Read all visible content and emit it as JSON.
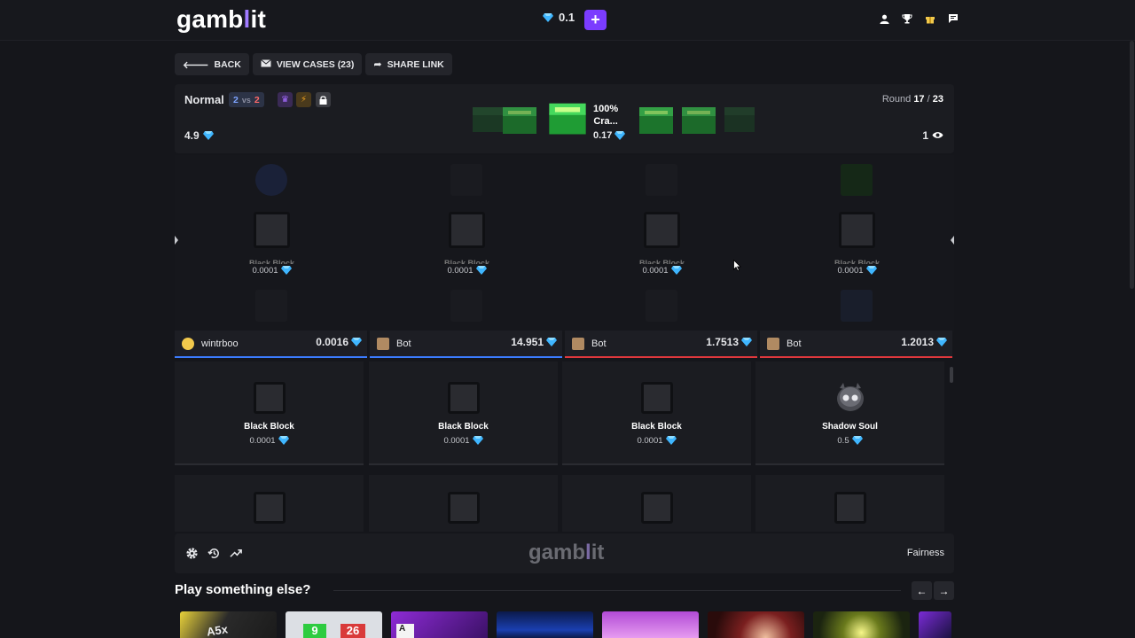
{
  "header": {
    "logo_a": "gamb",
    "logo_b": "l",
    "logo_c": "it",
    "balance": "0.1",
    "plus_label": "+",
    "icons": [
      "user-icon",
      "trophy-icon",
      "gift-icon",
      "chat-icon"
    ]
  },
  "toolbar": {
    "back_label": "BACK",
    "view_cases_label": "VIEW CASES (23)",
    "share_label": "SHARE LINK"
  },
  "battle": {
    "mode": "Normal",
    "team_a": "2",
    "vs": "vs",
    "team_b": "2",
    "total": "4.9",
    "round_label": "Round",
    "round_current": "17",
    "round_sep": "/",
    "round_total": "23",
    "viewers": "1",
    "case_title_1": "100%",
    "case_title_2": "Cra...",
    "case_price": "0.17"
  },
  "spinner": {
    "items": [
      {
        "label": "Black Block",
        "price": "0.0001"
      },
      {
        "label": "Black Block",
        "price": "0.0001"
      },
      {
        "label": "Black Block",
        "price": "0.0001"
      },
      {
        "label": "Black Block",
        "price": "0.0001"
      }
    ]
  },
  "players": [
    {
      "name": "wintrboo",
      "value": "0.0016",
      "team": "blue"
    },
    {
      "name": "Bot",
      "value": "14.951",
      "team": "blue"
    },
    {
      "name": "Bot",
      "value": "1.7513",
      "team": "red"
    },
    {
      "name": "Bot",
      "value": "1.2013",
      "team": "red"
    }
  ],
  "results": [
    {
      "label": "Black Block",
      "price": "0.0001"
    },
    {
      "label": "Black Block",
      "price": "0.0001"
    },
    {
      "label": "Black Block",
      "price": "0.0001"
    },
    {
      "label": "Shadow Soul",
      "price": "0.5"
    }
  ],
  "footer": {
    "logo_a": "gamb",
    "logo_b": "l",
    "logo_c": "it",
    "fairness": "Fairness"
  },
  "play_else": {
    "title": "Play something else?",
    "thumb_1_text": "A5x",
    "thumb_2_a": "9",
    "thumb_2_b": "26",
    "thumb_3_text": "A"
  },
  "colors": {
    "accent": "#7b3cff",
    "blue_team": "#3b7cff",
    "red_team": "#e0383d",
    "gem": "#3fb6ff",
    "bg": "#15161b"
  }
}
